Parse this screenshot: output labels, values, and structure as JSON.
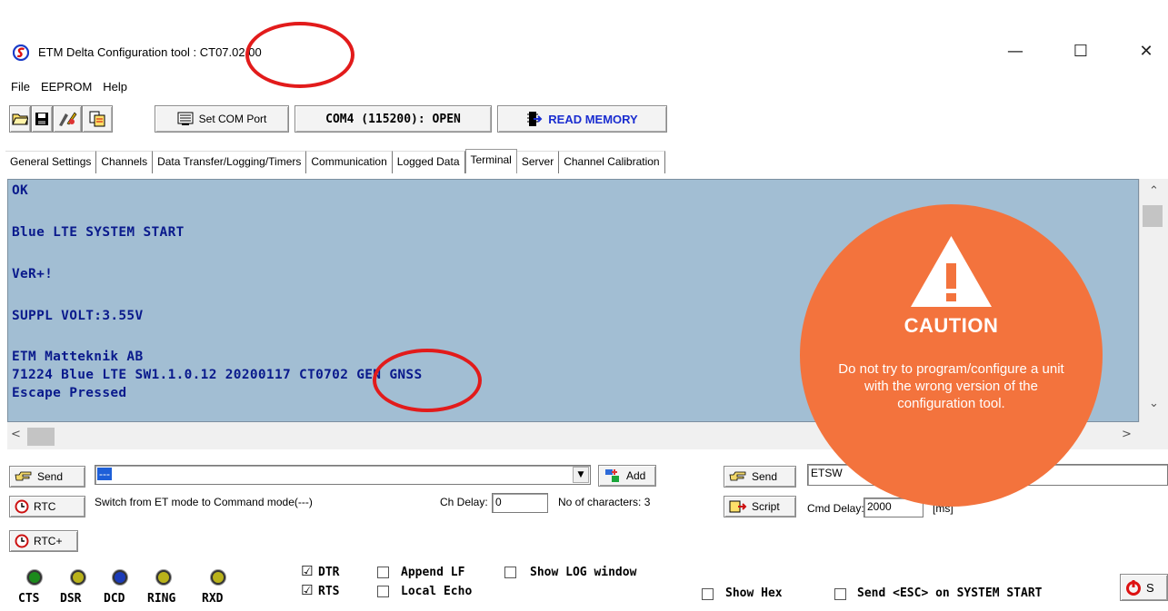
{
  "window": {
    "title": "ETM Delta Configuration tool : CT07.02.00",
    "minimize_glyph": "—",
    "maximize_glyph": "☐",
    "close_glyph": "✕"
  },
  "menu": [
    "File",
    "EEPROM",
    "Help"
  ],
  "toolbar": {
    "icons": [
      "open-folder-icon",
      "save-icon",
      "edit-icon",
      "copy-icon"
    ],
    "set_com_port": "Set COM Port",
    "com_status": "COM4 (115200): OPEN",
    "read_memory": "READ MEMORY"
  },
  "tabs": [
    "General Settings",
    "Channels",
    "Data Transfer/Logging/Timers",
    "Communication",
    "Logged Data",
    "Terminal",
    "Server",
    "Channel Calibration"
  ],
  "active_tab": "Terminal",
  "terminal": {
    "lines": [
      "OK",
      "Blue LTE SYSTEM START",
      "VeR+!",
      "SUPPL VOLT:3.55V",
      "ETM Matteknik AB",
      "71224 Blue LTE SW1.1.0.12 20200117 CT0702 GEN GNSS",
      "Escape Pressed"
    ]
  },
  "caution": {
    "title": "CAUTION",
    "icon": "warning-triangle-icon",
    "text": "Do not try to program/configure a unit with the wrong version of the configuration tool.",
    "color": "#f3733d"
  },
  "send_panel": {
    "send_label": "Send",
    "command_value": "---",
    "add_label": "Add",
    "rtc_label": "RTC",
    "rtc_plus_label": "RTC+",
    "description": "Switch from ET mode to Command mode(---)",
    "ch_delay_label": "Ch Delay:",
    "ch_delay_value": "0",
    "no_of_chars": "No of characters: 3",
    "script_send_label": "Send",
    "script_value": "ETSW",
    "script_label": "Script",
    "cmd_delay_label": "Cmd Delay:",
    "cmd_delay_value": "2000",
    "cmd_delay_unit": "[ms]"
  },
  "leds": [
    "CTS",
    "DSR",
    "DCD",
    "RING",
    "RXD"
  ],
  "options": {
    "dtr": {
      "label": "DTR",
      "checked": true
    },
    "rts": {
      "label": "RTS",
      "checked": true
    },
    "append_lf": {
      "label": "Append LF",
      "checked": false
    },
    "local_echo": {
      "label": "Local Echo",
      "checked": false
    },
    "show_log": {
      "label": "Show LOG window",
      "checked": false
    },
    "show_hex": {
      "label": "Show Hex",
      "checked": false
    },
    "send_esc": {
      "label": "Send <ESC> on SYSTEM START",
      "checked": false
    },
    "check_mark": "☑",
    "last_button": "S"
  },
  "annotation_color": "#e21b1b"
}
